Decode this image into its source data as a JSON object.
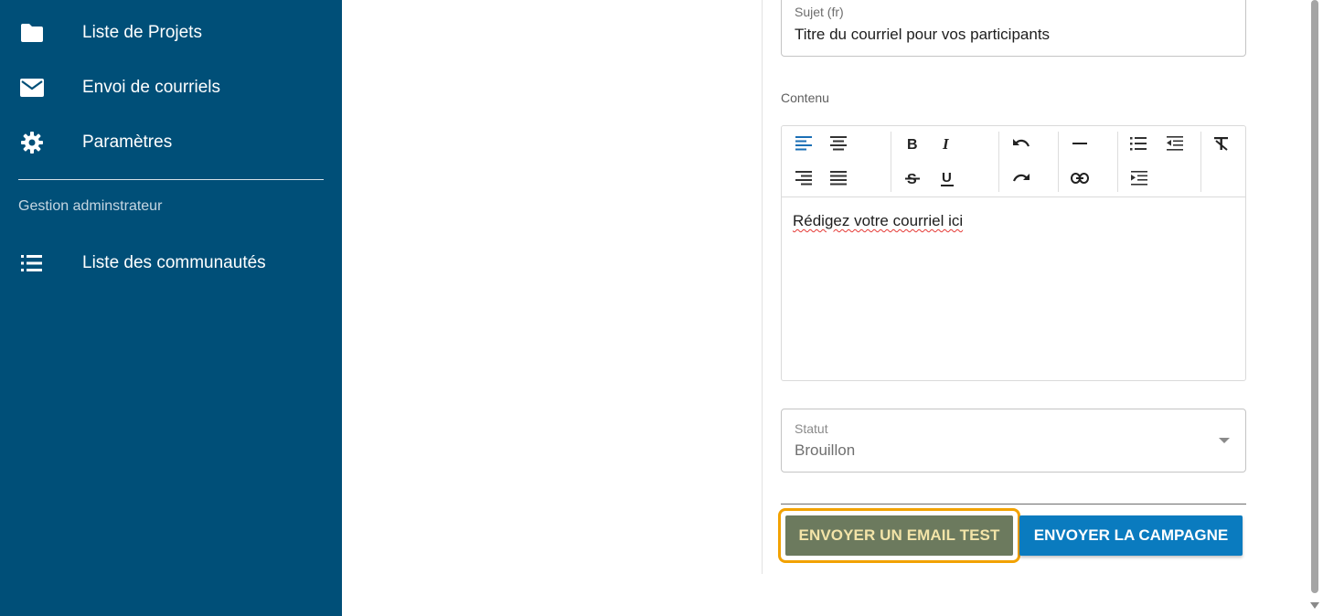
{
  "sidebar": {
    "items": [
      {
        "label": "Liste de Projets",
        "icon": "folder-icon"
      },
      {
        "label": "Envoi de courriels",
        "icon": "mail-icon"
      },
      {
        "label": "Paramètres",
        "icon": "gear-icon"
      }
    ],
    "section_label": "Gestion adminstrateur",
    "admin_items": [
      {
        "label": "Liste des communautés",
        "icon": "list-icon"
      }
    ],
    "background_color": "#004f78"
  },
  "form": {
    "subject": {
      "label": "Sujet (fr)",
      "value": "Titre du courriel pour vos participants"
    },
    "content": {
      "label": "Contenu",
      "body_text": "Rédigez votre courriel ici",
      "toolbar": [
        "align-left-icon",
        "align-center-icon",
        "align-right-icon",
        "align-justify-icon",
        "bold-icon",
        "italic-icon",
        "strikethrough-icon",
        "underline-icon",
        "undo-icon",
        "redo-icon",
        "horizontal-rule-icon",
        "link-icon",
        "bullet-list-icon",
        "outdent-icon",
        "indent-icon",
        "clear-format-icon"
      ]
    },
    "status": {
      "label": "Statut",
      "value": "Brouillon"
    }
  },
  "actions": {
    "test_label": "ENVOYER UN EMAIL TEST",
    "send_label": "ENVOYER LA CAMPAGNE",
    "test_color": "#6c7a5e",
    "send_color": "#0a7bbf",
    "highlight_color": "#f2a200"
  }
}
